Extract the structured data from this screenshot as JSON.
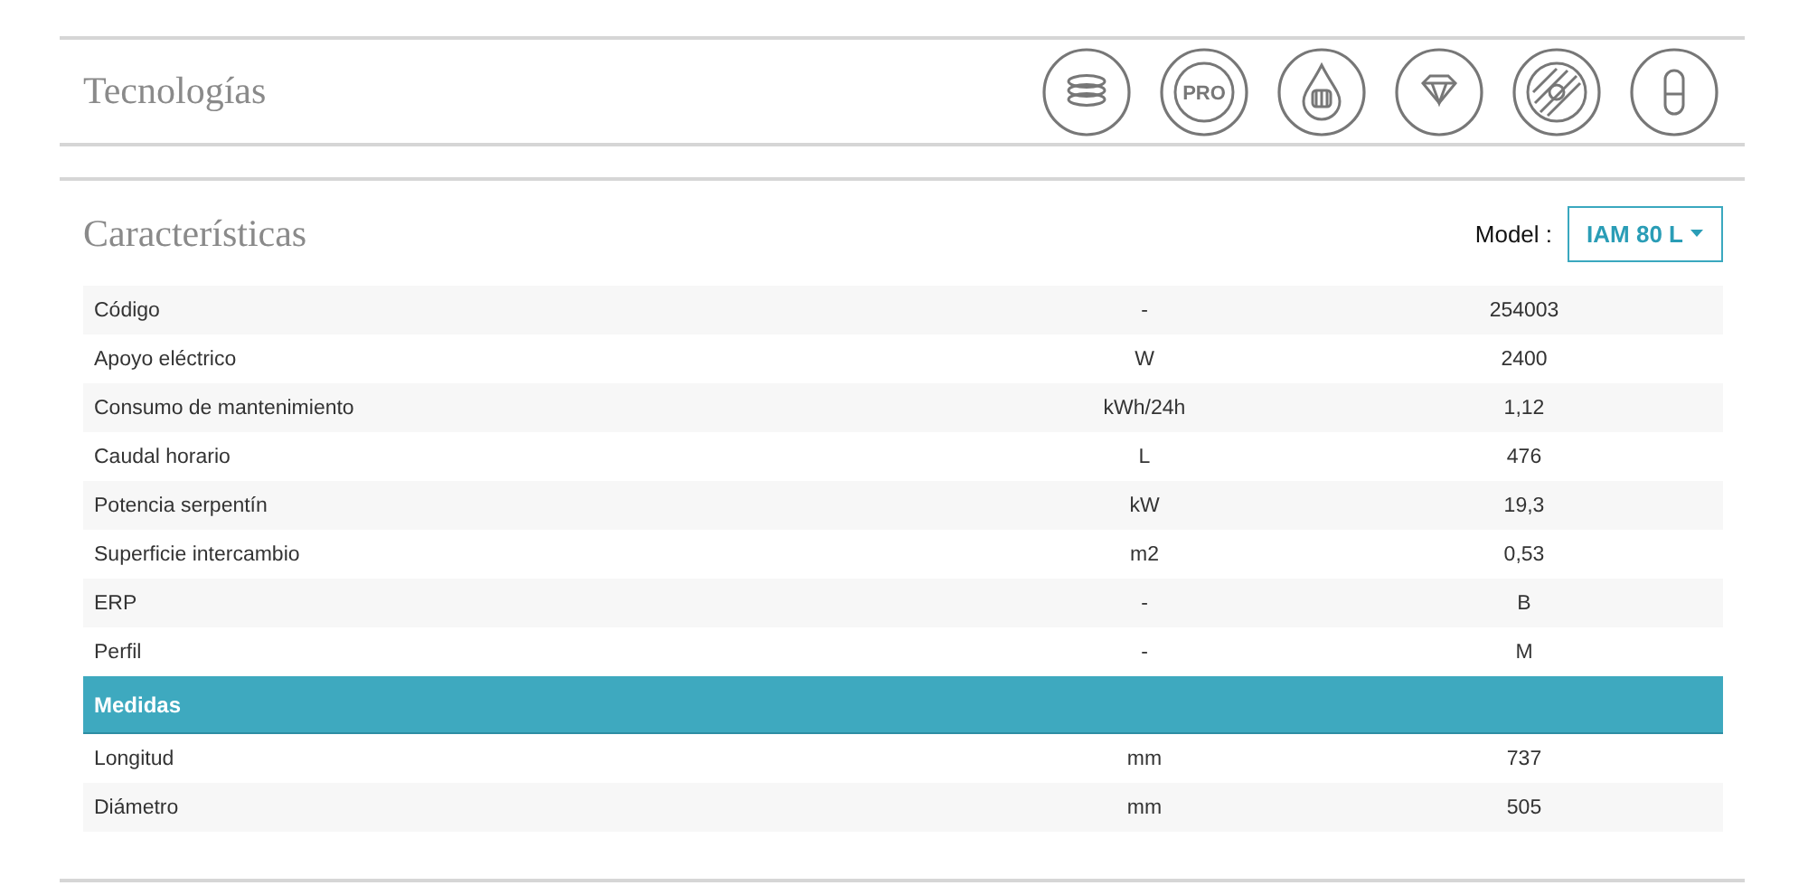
{
  "technologies": {
    "title": "Tecnologías",
    "icons": [
      {
        "kind": "stack"
      },
      {
        "kind": "badge",
        "label": "PRO"
      },
      {
        "kind": "drop"
      },
      {
        "kind": "diamond"
      },
      {
        "kind": "disc"
      },
      {
        "kind": "capsule"
      }
    ]
  },
  "characteristics": {
    "title": "Características",
    "model_label": "Model :",
    "model_value": "IAM 80 L",
    "sections": [
      {
        "rows": [
          {
            "name": "Código",
            "unit": "-",
            "value": "254003"
          },
          {
            "name": "Apoyo eléctrico",
            "unit": "W",
            "value": "2400"
          },
          {
            "name": "Consumo de mantenimiento",
            "unit": "kWh/24h",
            "value": "1,12"
          },
          {
            "name": "Caudal horario",
            "unit": "L",
            "value": "476"
          },
          {
            "name": "Potencia serpentín",
            "unit": "kW",
            "value": "19,3"
          },
          {
            "name": "Superficie intercambio",
            "unit": "m2",
            "value": "0,53"
          },
          {
            "name": "ERP",
            "unit": "-",
            "value": "B"
          },
          {
            "name": "Perfil",
            "unit": "-",
            "value": "M"
          }
        ]
      },
      {
        "heading": "Medidas",
        "rows": [
          {
            "name": "Longitud",
            "unit": "mm",
            "value": "737"
          },
          {
            "name": "Diámetro",
            "unit": "mm",
            "value": "505"
          }
        ]
      }
    ]
  }
}
